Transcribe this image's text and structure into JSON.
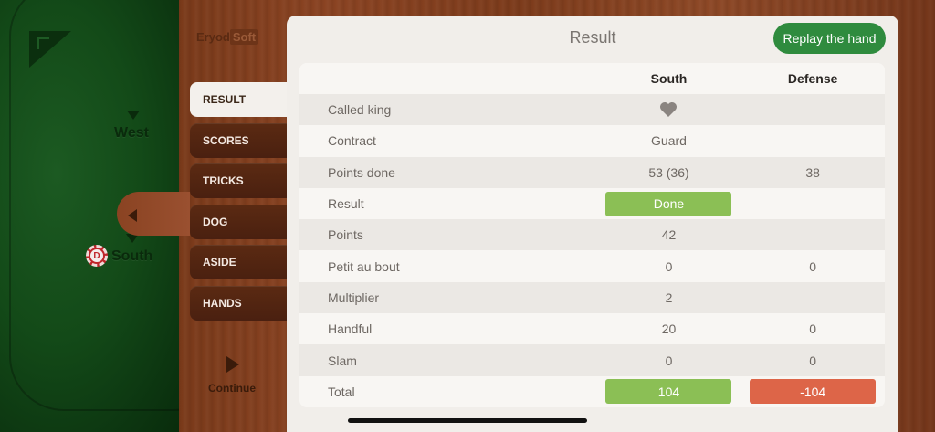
{
  "brand": {
    "part1": "Eryod",
    "part2": "Soft"
  },
  "table_seats": {
    "west": "West",
    "south": "South",
    "dealer_badge": "D"
  },
  "sidebar": {
    "items": [
      {
        "label": "RESULT",
        "active": true
      },
      {
        "label": "SCORES"
      },
      {
        "label": "TRICKS"
      },
      {
        "label": "DOG"
      },
      {
        "label": "ASIDE"
      },
      {
        "label": "HANDS"
      }
    ],
    "continue_label": "Continue"
  },
  "panel": {
    "title": "Result",
    "replay_label": "Replay the hand",
    "columns": [
      "South",
      "Defense"
    ],
    "rows": [
      {
        "label": "Called king",
        "south": "heart-icon",
        "defense": ""
      },
      {
        "label": "Contract",
        "south": "Guard",
        "defense": ""
      },
      {
        "label": "Points done",
        "south": "53 (36)",
        "defense": "38"
      },
      {
        "label": "Result",
        "south": "Done",
        "defense": ""
      },
      {
        "label": "Points",
        "south": "42",
        "defense": ""
      },
      {
        "label": "Petit au bout",
        "south": "0",
        "defense": "0"
      },
      {
        "label": "Multiplier",
        "south": "2",
        "defense": ""
      },
      {
        "label": "Handful",
        "south": "20",
        "defense": "0"
      },
      {
        "label": "Slam",
        "south": "0",
        "defense": "0"
      },
      {
        "label": "Total",
        "south": "104",
        "defense": "-104"
      }
    ]
  },
  "colors": {
    "positive": "#8bbf55",
    "negative": "#dd6548",
    "replay_button": "#2f8b3e",
    "felt": "#134a18"
  }
}
